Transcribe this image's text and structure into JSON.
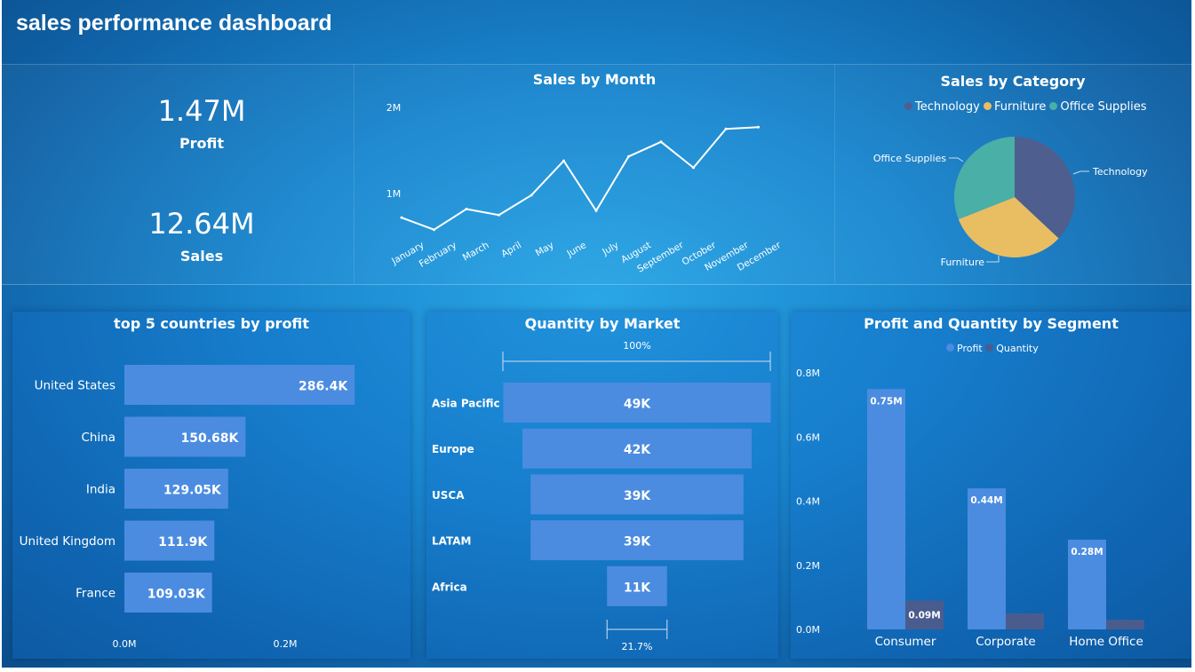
{
  "header": {
    "title": "sales performance dashboard"
  },
  "kpis": [
    {
      "value": "1.47M",
      "label": "Profit"
    },
    {
      "value": "12.64M",
      "label": "Sales"
    }
  ],
  "colors": {
    "bar": "#4b8ce0",
    "technology": "#4e5f8f",
    "furniture": "#e9bd62",
    "office_supplies": "#4aafa7",
    "profit": "#4b8ce0",
    "quantity": "#4a5c8e"
  },
  "chart_data": [
    {
      "type": "line",
      "title": "Sales by Month",
      "x": [
        "January",
        "February",
        "March",
        "April",
        "May",
        "June",
        "July",
        "August",
        "September",
        "October",
        "November",
        "December"
      ],
      "values": [
        0.72,
        0.58,
        0.82,
        0.75,
        0.98,
        1.38,
        0.8,
        1.43,
        1.6,
        1.3,
        1.75,
        1.77
      ],
      "ytick_labels": [
        "2M",
        "1M"
      ],
      "ylim": [
        0,
        2
      ]
    },
    {
      "type": "pie",
      "title": "Sales by Category",
      "legend": [
        "Technology",
        "Furniture",
        "Office Supplies"
      ],
      "slices": [
        {
          "label": "Technology",
          "value": 37
        },
        {
          "label": "Furniture",
          "value": 32
        },
        {
          "label": "Office Supplies",
          "value": 31
        }
      ]
    },
    {
      "type": "bar",
      "title": "top 5 countries by profit",
      "categories": [
        "United States",
        "China",
        "India",
        "United Kingdom",
        "France"
      ],
      "values": [
        286.4,
        150.68,
        129.05,
        111.9,
        109.03
      ],
      "data_labels": [
        "286.4K",
        "150.68K",
        "129.05K",
        "111.9K",
        "109.03K"
      ],
      "xtick_labels": [
        "0.0M",
        "0.2M"
      ]
    },
    {
      "type": "bar",
      "title": "Quantity by Market",
      "categories": [
        "Asia Pacific",
        "Europe",
        "USCA",
        "LATAM",
        "Africa"
      ],
      "values": [
        49,
        42,
        39,
        39,
        11
      ],
      "data_labels": [
        "49K",
        "42K",
        "39K",
        "39K",
        "11K"
      ],
      "top_percent_label": "100%",
      "bottom_percent_label": "21.7%"
    },
    {
      "type": "bar",
      "title": "Profit and Quantity by Segment",
      "categories": [
        "Consumer",
        "Corporate",
        "Home Office"
      ],
      "series": [
        {
          "name": "Profit",
          "values": [
            0.75,
            0.44,
            0.28
          ],
          "data_labels": [
            "0.75M",
            "0.44M",
            "0.28M"
          ]
        },
        {
          "name": "Quantity",
          "values": [
            0.09,
            0.05,
            0.03
          ],
          "data_labels": [
            "0.09M",
            "",
            ""
          ]
        }
      ],
      "ytick_labels": [
        "0.8M",
        "0.6M",
        "0.4M",
        "0.2M",
        "0.0M"
      ],
      "ylim": [
        0,
        0.8
      ]
    }
  ]
}
